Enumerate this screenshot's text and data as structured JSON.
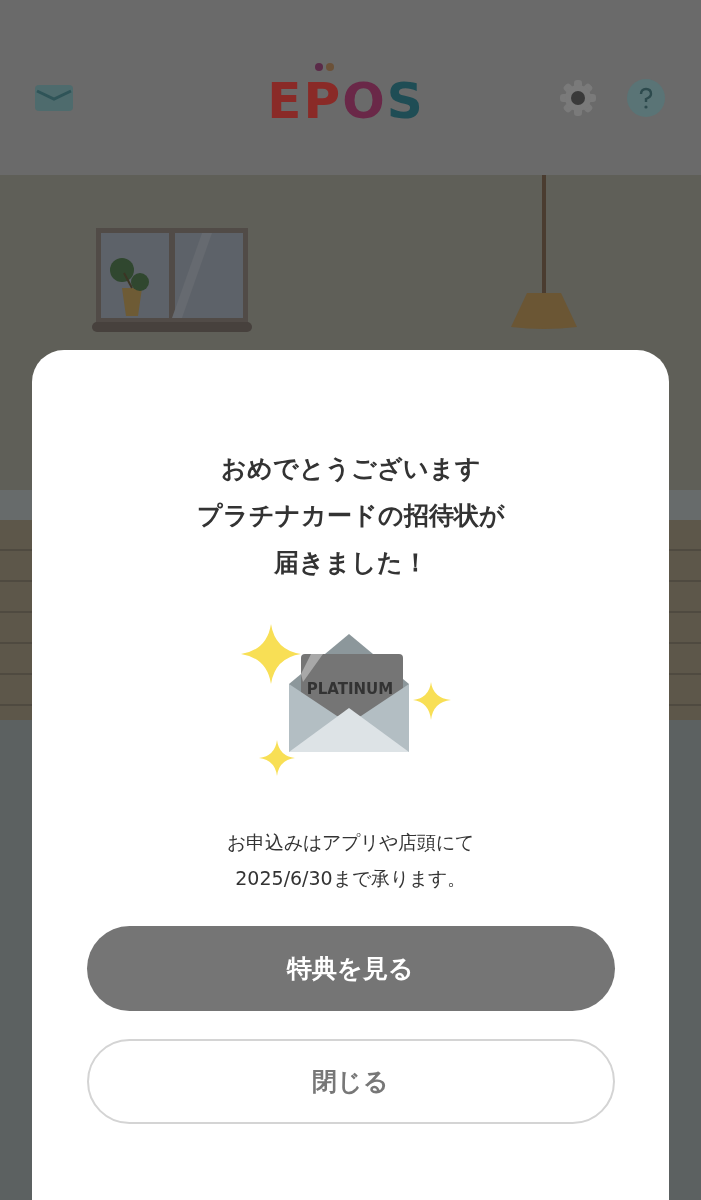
{
  "header": {
    "logo": "EPOS"
  },
  "dialog": {
    "title_lines": [
      "おめでとうございます",
      "プラチナカードの招待状が",
      "届きました！"
    ],
    "illustration": {
      "card_label": "PLATINUM"
    },
    "message_lines": [
      "お申込みはアプリや店頭にて",
      "2025/6/30まで承ります。"
    ],
    "buttons": [
      {
        "label": "特典を見る",
        "kind": "primary"
      },
      {
        "label": "閉じる",
        "kind": "secondary"
      }
    ]
  }
}
